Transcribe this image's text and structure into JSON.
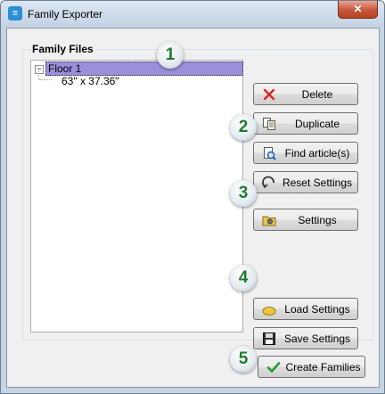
{
  "window": {
    "title": "Family Exporter",
    "close_icon": "close-icon",
    "app_icon": "app-logo-icon",
    "close_color": "#c85a3f"
  },
  "family_files": {
    "group_label": "Family Files",
    "tree": {
      "root": {
        "label": "Floor 1",
        "expanded": true,
        "selected": true,
        "expander": "⊟"
      },
      "children": [
        {
          "label": "63\" x 37.36\""
        }
      ]
    },
    "selection_color": "#9b8fdc"
  },
  "buttons": {
    "delete": {
      "label": "Delete",
      "icon": "red-x-icon"
    },
    "duplicate": {
      "label": "Duplicate",
      "icon": "duplicate-icon"
    },
    "find": {
      "label": "Find article(s)",
      "icon": "find-icon"
    },
    "reset": {
      "label": "Reset Settings",
      "icon": "reset-arrow-icon"
    },
    "settings": {
      "label": "Settings",
      "icon": "settings-icon"
    },
    "load": {
      "label": "Load Settings",
      "icon": "folder-icon"
    },
    "save": {
      "label": "Save Settings",
      "icon": "floppy-disk-icon"
    },
    "create": {
      "label": "Create Families",
      "icon": "checkmark-icon"
    }
  },
  "callouts": [
    "1",
    "2",
    "3",
    "4",
    "5"
  ],
  "callout_color": "#1d7f2e"
}
